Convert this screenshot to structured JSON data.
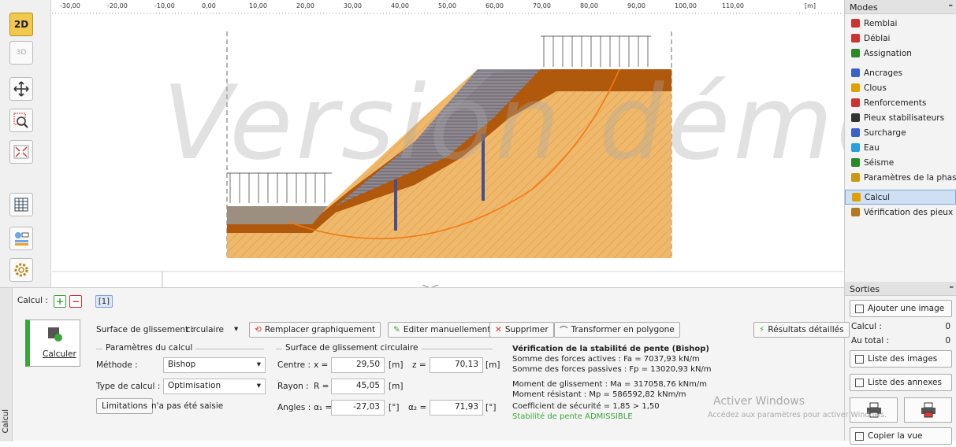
{
  "toolbar": {
    "view_2d": "2D",
    "view_3d": "3D"
  },
  "ruler": {
    "ticks": [
      "-30,00",
      "-20,00",
      "-10,00",
      "0,00",
      "10,00",
      "20,00",
      "30,00",
      "40,00",
      "50,00",
      "60,00",
      "70,00",
      "80,00",
      "90,00",
      "100,00",
      "110,00"
    ],
    "unit": "[m]"
  },
  "watermark": "Version démo",
  "modes": {
    "title": "Modes",
    "items": [
      "Remblai",
      "Déblai",
      "Assignation",
      "Ancrages",
      "Clous",
      "Renforcements",
      "Pieux stabilisateurs",
      "Surcharge",
      "Eau",
      "Séisme",
      "Paramètres de la phase",
      "Calcul",
      "Vérification des pieux"
    ],
    "active": "Calcul"
  },
  "sorties": {
    "title": "Sorties",
    "add_image": "Ajouter une image",
    "calcul_label": "Calcul :",
    "calcul_value": "0",
    "total_label": "Au total :",
    "total_value": "0",
    "list_images": "Liste des images",
    "list_annexes": "Liste des annexes",
    "copy_view": "Copier la vue"
  },
  "calc": {
    "label": "Calcul :",
    "tab": "[1]",
    "run_button": "Calculer",
    "side_tab": "Calcul",
    "surface_label": "Surface de glissement :",
    "surface_value": "circulaire",
    "replace_graphic": "Remplacer graphiquement",
    "edit_manual": "Editer manuellement",
    "delete": "Supprimer",
    "to_polygon": "Transformer en polygone",
    "detailed_results": "Résultats détaillés",
    "params_title": "Paramètres du calcul",
    "method_label": "Méthode :",
    "method_value": "Bishop",
    "type_label": "Type de calcul :",
    "type_value": "Optimisation",
    "limitations_btn": "Limitations",
    "limitations_text": "n'a pas été saisie",
    "circle_title": "Surface de glissement circulaire",
    "centre_label": "Centre :",
    "x_label": "x =",
    "x_value": "29,50",
    "z_label": "z =",
    "z_value": "70,13",
    "unit_m": "[m]",
    "radius_label": "Rayon :",
    "r_label": "R =",
    "r_value": "45,05",
    "angles_label": "Angles :",
    "a1_label": "α₁ =",
    "a1_value": "-27,03",
    "a2_label": "α₂ =",
    "a2_value": "71,93",
    "unit_deg": "[°]"
  },
  "verification": {
    "title": "Vérification de la stabilité de pente (Bishop)",
    "line1": "Somme des forces actives :    Fa =    7037,93  kN/m",
    "line2": "Somme des forces passives :  Fp =  13020,93  kN/m",
    "line3": "Moment de glissement :         Ma = 317058,76  kNm/m",
    "line4": "Moment résistant :               Mp = 586592,82  kNm/m",
    "line5": "Coefficient de sécurité = 1,85 > 1,50",
    "line6": "Stabilité de pente ADMISSIBLE"
  },
  "activation": {
    "title": "Activer Windows",
    "subtitle": "Accédez aux paramètres pour activer Windows."
  },
  "colors": {
    "accent_green": "#3aa63a",
    "soil_top": "#b0580c",
    "soil_body": "#f0b86a",
    "backfill": "#9a8f82"
  }
}
